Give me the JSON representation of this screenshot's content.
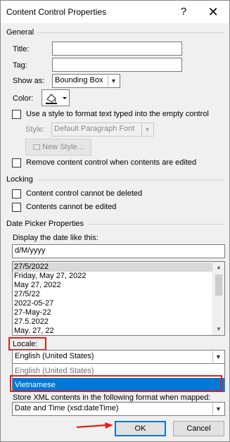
{
  "window": {
    "title": "Content Control Properties",
    "help_glyph": "?",
    "close_glyph": "✕"
  },
  "general": {
    "group_label": "General",
    "title_label": "Title:",
    "title_value": "",
    "tag_label": "Tag:",
    "tag_value": "",
    "show_as_label": "Show as:",
    "show_as_value": "Bounding Box",
    "color_label": "Color:",
    "use_style_label": "Use a style to format text typed into the empty control",
    "use_style_checked": false,
    "style_label": "Style:",
    "style_value": "Default Paragraph Font",
    "new_style_label": "New Style...",
    "remove_label": "Remove content control when contents are edited",
    "remove_checked": false
  },
  "locking": {
    "group_label": "Locking",
    "cannot_delete_label": "Content control cannot be deleted",
    "cannot_delete_checked": false,
    "cannot_edit_label": "Contents cannot be edited",
    "cannot_edit_checked": false
  },
  "date_picker": {
    "group_label": "Date Picker Properties",
    "display_label": "Display the date like this:",
    "format_value": "d/M/yyyy",
    "formats": [
      "27/5/2022",
      "Friday, May 27, 2022",
      "May 27, 2022",
      "27/5/22",
      "2022-05-27",
      "27-May-22",
      "27.5.2022",
      "May. 27, 22"
    ],
    "selected_format_index": 0,
    "locale_label": "Locale:",
    "locale_value": "English (United States)",
    "locale_options": [
      "English (United States)",
      "Vietnamese"
    ],
    "locale_highlighted_index": 1,
    "store_label": "Store XML contents in the following format when mapped:",
    "store_value": "Date and Time (xsd:dateTime)"
  },
  "buttons": {
    "ok": "OK",
    "cancel": "Cancel"
  },
  "colors": {
    "highlight": "#0078d7",
    "annotation_red": "#e0201c"
  }
}
